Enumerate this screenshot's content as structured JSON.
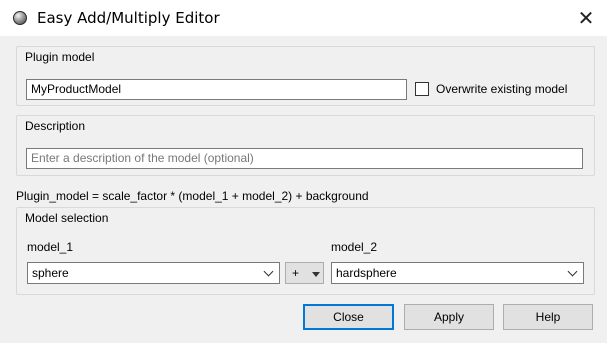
{
  "window": {
    "title": "Easy Add/Multiply Editor"
  },
  "plugin_model": {
    "group_label": "Plugin model",
    "name_value": "MyProductModel",
    "overwrite_label": "Overwrite existing model",
    "overwrite_checked": false
  },
  "description": {
    "group_label": "Description",
    "placeholder": "Enter a description of the model (optional)",
    "value": ""
  },
  "formula_text": "Plugin_model = scale_factor * (model_1 + model_2) + background",
  "model_selection": {
    "group_label": "Model selection",
    "model1_label": "model_1",
    "model1_value": "sphere",
    "operator_value": "+",
    "model2_label": "model_2",
    "model2_value": "hardsphere"
  },
  "buttons": {
    "close": "Close",
    "apply": "Apply",
    "help": "Help"
  },
  "colors": {
    "default_button_border": "#0078d7",
    "window_bg": "#f0f0f0"
  },
  "icons": [
    "app-icon",
    "close-icon",
    "chevron-down-icon",
    "triangle-down-icon"
  ]
}
